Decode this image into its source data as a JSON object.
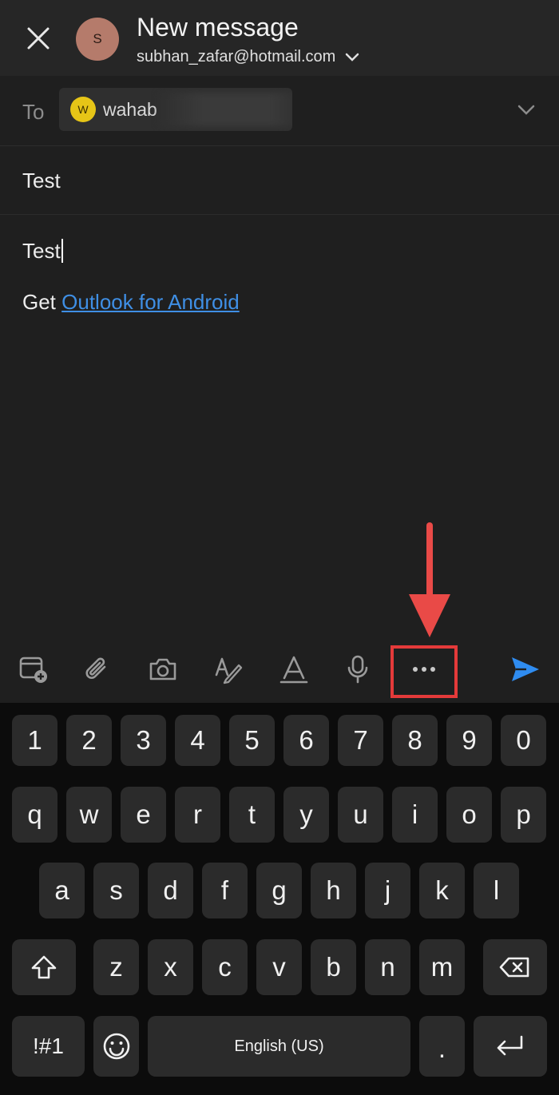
{
  "header": {
    "title": "New message",
    "from_email": "subhan_zafar@hotmail.com",
    "avatar_initial": "S"
  },
  "to": {
    "label": "To",
    "chip_initial": "W",
    "chip_name": "wahab"
  },
  "subject": "Test",
  "body": {
    "text": "Test",
    "signature_prefix": "Get ",
    "signature_link": "Outlook for Android"
  },
  "toolbar": {
    "icons": [
      "calendar-add-icon",
      "attach-icon",
      "camera-icon",
      "draw-icon",
      "format-text-icon",
      "microphone-icon",
      "more-options-icon",
      "send-icon"
    ],
    "more_label": "···"
  },
  "annotation": {
    "color": "#e43a3a"
  },
  "keyboard": {
    "numbers": [
      "1",
      "2",
      "3",
      "4",
      "5",
      "6",
      "7",
      "8",
      "9",
      "0"
    ],
    "row1": [
      "q",
      "w",
      "e",
      "r",
      "t",
      "y",
      "u",
      "i",
      "o",
      "p"
    ],
    "row2": [
      "a",
      "s",
      "d",
      "f",
      "g",
      "h",
      "j",
      "k",
      "l"
    ],
    "row3": [
      "z",
      "x",
      "c",
      "v",
      "b",
      "n",
      "m"
    ],
    "symbols_label": "!#1",
    "space_label": "English (US)",
    "period_label": "."
  },
  "colors": {
    "accent": "#3f8fe5",
    "send": "#2f8cf0",
    "arrow": "#e94a47"
  }
}
